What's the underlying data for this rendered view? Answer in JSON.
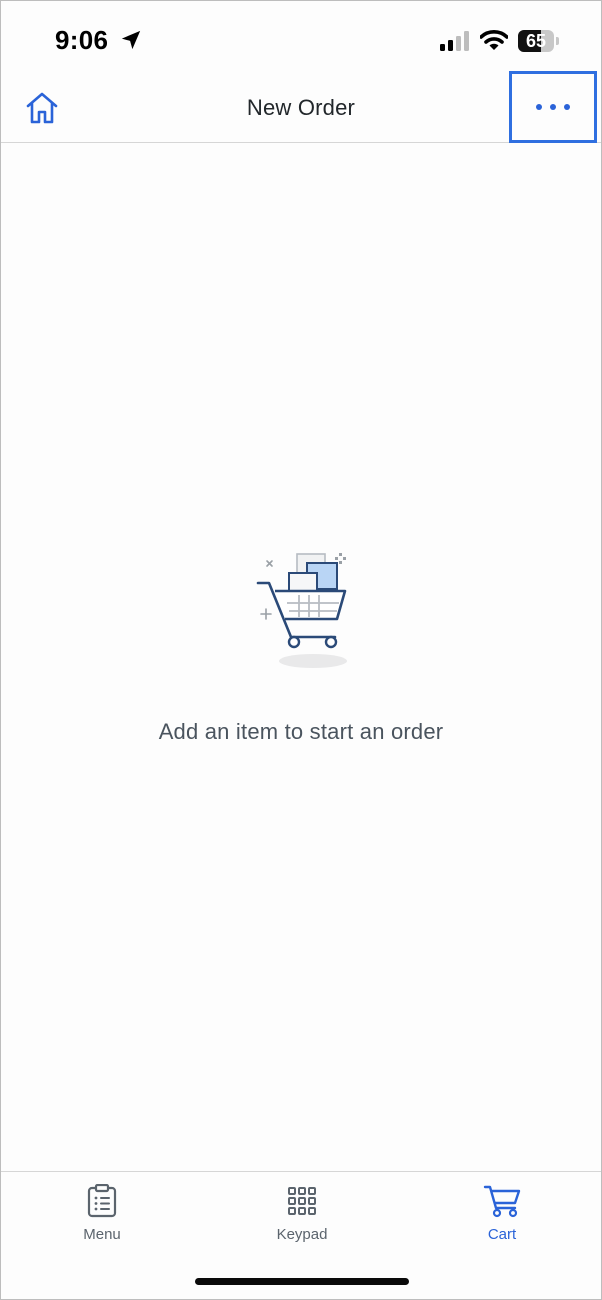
{
  "status_bar": {
    "time": "9:06",
    "battery_level": "65",
    "battery_percent": 65,
    "icons": [
      "location-arrow-icon",
      "cellular-signal-icon",
      "wifi-icon",
      "battery-icon"
    ]
  },
  "header": {
    "title": "New Order",
    "left_icon": "home-icon",
    "right_icon": "more-options-icon",
    "highlight_color": "#2f6fe0"
  },
  "empty_state": {
    "icon": "shopping-cart-illustration",
    "message": "Add an item to start an order"
  },
  "tab_bar": {
    "active_tab": "Cart",
    "accent_color": "#2a63d8",
    "tabs": [
      {
        "label": "Menu",
        "icon": "clipboard-list-icon"
      },
      {
        "label": "Keypad",
        "icon": "keypad-grid-icon"
      },
      {
        "label": "Cart",
        "icon": "cart-icon"
      }
    ]
  }
}
